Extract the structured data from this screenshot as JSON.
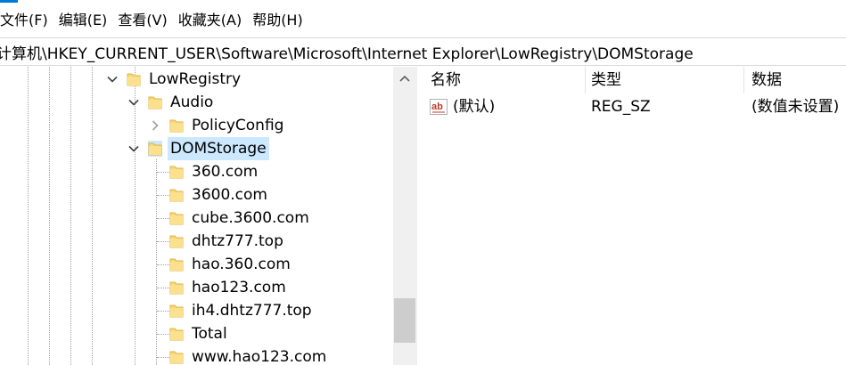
{
  "menu": {
    "file": "文件(F)",
    "edit": "编辑(E)",
    "view": "查看(V)",
    "favorites": "收藏夹(A)",
    "help": "帮助(H)"
  },
  "address": "计算机\\HKEY_CURRENT_USER\\Software\\Microsoft\\Internet Explorer\\LowRegistry\\DOMStorage",
  "tree": {
    "lowregistry": "LowRegistry",
    "audio": "Audio",
    "policyconfig": "PolicyConfig",
    "domstorage": "DOMStorage",
    "children": [
      "360.com",
      "3600.com",
      "cube.3600.com",
      "dhtz777.top",
      "hao.360.com",
      "hao123.com",
      "ih4.dhtz777.top",
      "Total",
      "www.hao123.com"
    ]
  },
  "list": {
    "headers": {
      "name": "名称",
      "type": "类型",
      "data": "数据"
    },
    "rows": [
      {
        "name": "(默认)",
        "type": "REG_SZ",
        "data": "(数值未设置)"
      }
    ]
  },
  "colors": {
    "selection": "#cce8ff",
    "folder": "#f8d775",
    "accent": "#0078d7"
  },
  "icons": {
    "folder": "folder-icon",
    "expand": "chevron-down-icon",
    "collapsed": "chevron-right-icon",
    "string_value": "ab-string-icon"
  }
}
